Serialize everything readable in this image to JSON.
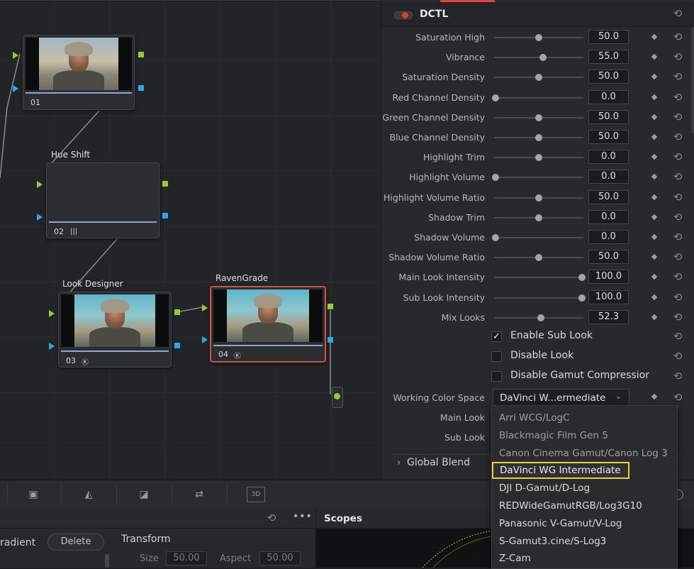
{
  "nodes": [
    {
      "num": "01",
      "title": "",
      "badge": ""
    },
    {
      "num": "02",
      "title": "Hue Shift",
      "badge": "|||"
    },
    {
      "num": "03",
      "title": "Look Designer",
      "badge": "Ⓚ"
    },
    {
      "num": "04",
      "title": "RavenGrade",
      "badge": "Ⓚ"
    }
  ],
  "inspector": {
    "title": "DCTL",
    "params": [
      {
        "label": "Saturation High",
        "value": "50.0",
        "pos": 0.5
      },
      {
        "label": "Vibrance",
        "value": "55.0",
        "pos": 0.55
      },
      {
        "label": "Saturation Density",
        "value": "50.0",
        "pos": 0.5
      },
      {
        "label": "Red Channel Density",
        "value": "0.0",
        "pos": 0.0
      },
      {
        "label": "Green Channel Density",
        "value": "50.0",
        "pos": 0.5
      },
      {
        "label": "Blue Channel Density",
        "value": "50.0",
        "pos": 0.5
      },
      {
        "label": "Highlight Trim",
        "value": "0.0",
        "pos": 0.5
      },
      {
        "label": "Highlight Volume",
        "value": "0.0",
        "pos": 0.0
      },
      {
        "label": "Highlight Volume Ratio",
        "value": "50.0",
        "pos": 0.5
      },
      {
        "label": "Shadow Trim",
        "value": "0.0",
        "pos": 0.5
      },
      {
        "label": "Shadow Volume",
        "value": "0.0",
        "pos": 0.0
      },
      {
        "label": "Shadow Volume Ratio",
        "value": "50.0",
        "pos": 0.5
      },
      {
        "label": "Main Look Intensity",
        "value": "100.0",
        "pos": 1.0
      },
      {
        "label": "Sub Look Intensity",
        "value": "100.0",
        "pos": 1.0
      },
      {
        "label": "Mix Looks",
        "value": "52.3",
        "pos": 0.523
      }
    ],
    "checkboxes": [
      {
        "label": "Enable Sub Look",
        "checked": true,
        "mark": "✓"
      },
      {
        "label": "Disable Look",
        "checked": false,
        "mark": ""
      },
      {
        "label": "Disable Gamut Compressior",
        "checked": false,
        "mark": ""
      }
    ],
    "working_color_space": {
      "label": "Working Color Space",
      "value": "DaVinci W...ermediate"
    },
    "main_look_label": "Main Look",
    "sub_look_label": "Sub Look",
    "global_blend": "Global Blend"
  },
  "dropdown_options": [
    "Arri WCG/LogC",
    "Blackmagic Film Gen 5",
    "Canon Cinema Gamut/Canon Log 3",
    "DaVinci WG Intermediate",
    "DJI D-Gamut/D-Log",
    "REDWideGamutRGB/Log3G10",
    "Panasonic V-Gamut/V-Log",
    "S-Gamut3.cine/S-Log3",
    "Z-Cam"
  ],
  "dropdown_selected_index": 3,
  "toolbar": {
    "threed_label": "3D"
  },
  "bottom": {
    "gradient_label": "radient",
    "delete_label": "Delete",
    "transform_title": "Transform",
    "size_label": "Size",
    "size_value": "50.00",
    "aspect_label": "Aspect",
    "aspect_value": "50.00",
    "scopes_title": "Scopes"
  },
  "colors": {
    "accent_red": "#e0453a",
    "highlight_yellow": "#e8d234",
    "port_green": "#8ed12a",
    "port_blue": "#26a9e8"
  }
}
